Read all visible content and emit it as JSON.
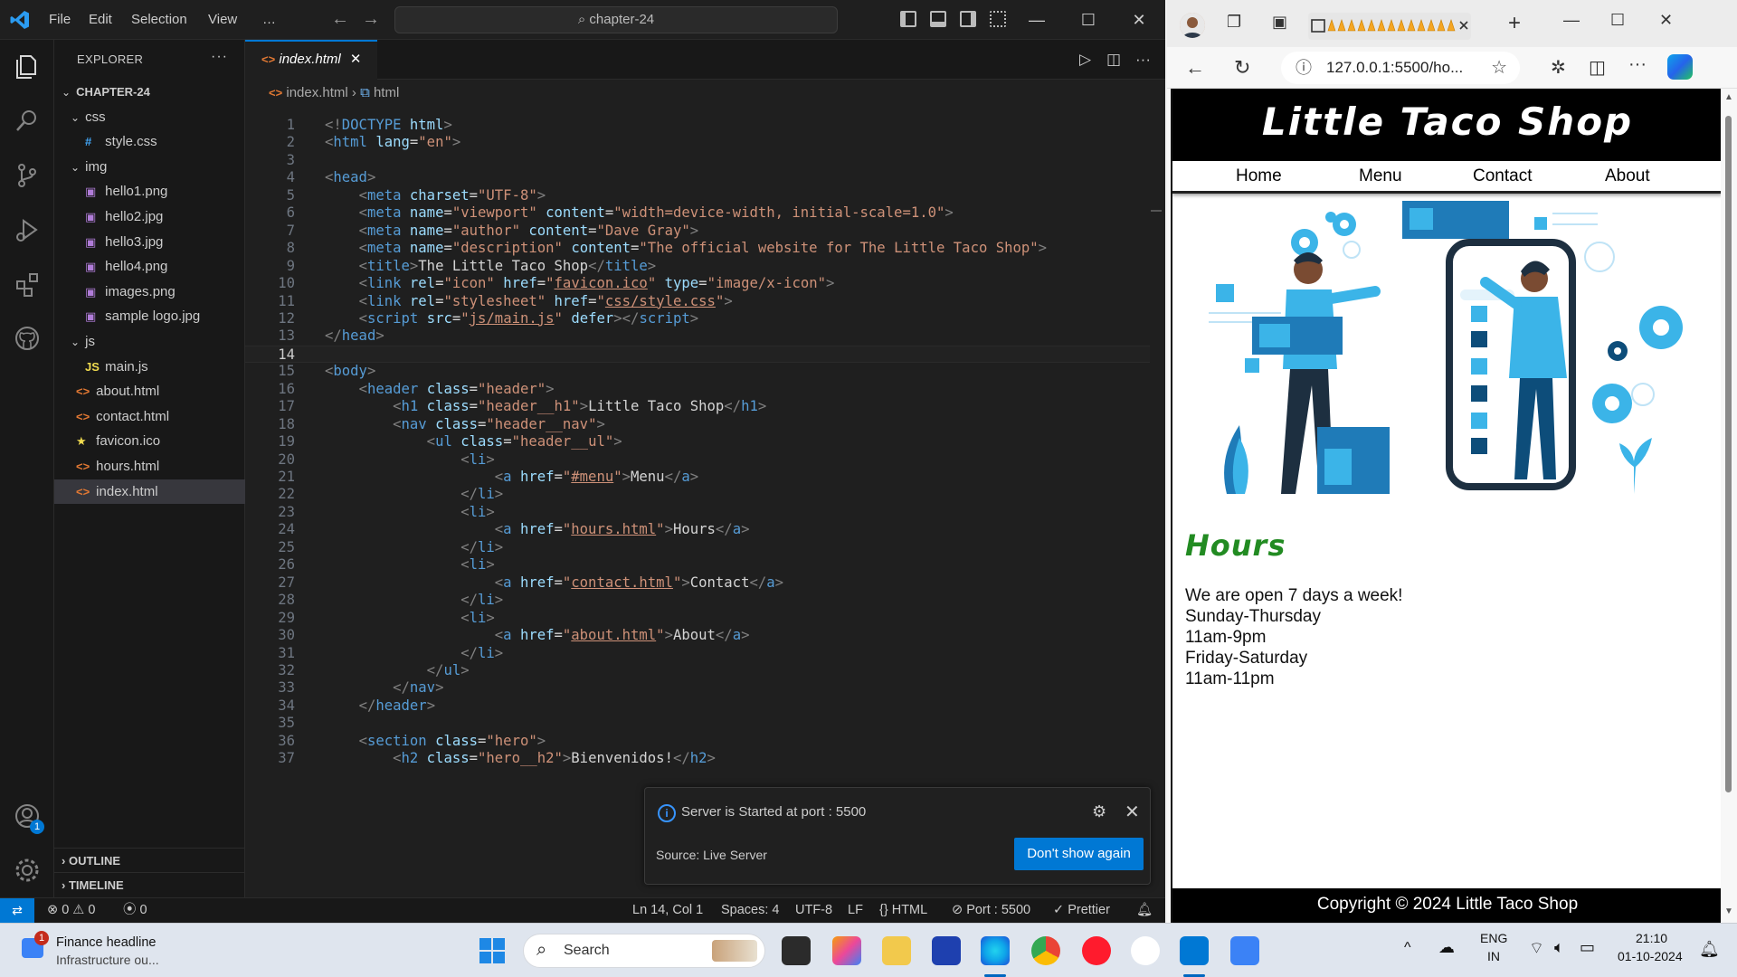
{
  "vscode": {
    "menu": [
      "File",
      "Edit",
      "Selection",
      "View",
      "…"
    ],
    "search_text": "chapter-24",
    "explorer_title": "EXPLORER",
    "explorer_more": "···",
    "tree": [
      {
        "label": "CHAPTER-24",
        "type": "root",
        "indent": 0
      },
      {
        "label": "css",
        "type": "folder",
        "indent": 1
      },
      {
        "label": "style.css",
        "type": "css",
        "indent": 2
      },
      {
        "label": "img",
        "type": "folder",
        "indent": 1
      },
      {
        "label": "hello1.png",
        "type": "image",
        "indent": 2
      },
      {
        "label": "hello2.jpg",
        "type": "image",
        "indent": 2
      },
      {
        "label": "hello3.jpg",
        "type": "image",
        "indent": 2
      },
      {
        "label": "hello4.png",
        "type": "image",
        "indent": 2
      },
      {
        "label": "images.png",
        "type": "image",
        "indent": 2
      },
      {
        "label": "sample logo.jpg",
        "type": "image",
        "indent": 2
      },
      {
        "label": "js",
        "type": "folder",
        "indent": 1
      },
      {
        "label": "main.js",
        "type": "js",
        "indent": 2
      },
      {
        "label": "about.html",
        "type": "html",
        "indent": 1
      },
      {
        "label": "contact.html",
        "type": "html",
        "indent": 1
      },
      {
        "label": "favicon.ico",
        "type": "ico",
        "indent": 1
      },
      {
        "label": "hours.html",
        "type": "html",
        "indent": 1
      },
      {
        "label": "index.html",
        "type": "html",
        "indent": 1,
        "selected": true
      }
    ],
    "outline_label": "OUTLINE",
    "timeline_label": "TIMELINE",
    "tab_label": "index.html",
    "breadcrumb": [
      "index.html",
      "html"
    ],
    "current_line": 14,
    "code_lines": [
      [
        [
          "tb",
          "<!"
        ],
        [
          "tg",
          "DOCTYPE"
        ],
        [
          "tx",
          " "
        ],
        [
          "at",
          "html"
        ],
        [
          "tb",
          ">"
        ]
      ],
      [
        [
          "tb",
          "<"
        ],
        [
          "tg",
          "html"
        ],
        [
          "tx",
          " "
        ],
        [
          "at",
          "lang"
        ],
        [
          "tx",
          "="
        ],
        [
          "st",
          "\"en\""
        ],
        [
          "tb",
          ">"
        ]
      ],
      [],
      [
        [
          "tb",
          "<"
        ],
        [
          "tg",
          "head"
        ],
        [
          "tb",
          ">"
        ]
      ],
      [
        [
          "tx",
          "    "
        ],
        [
          "tb",
          "<"
        ],
        [
          "tg",
          "meta"
        ],
        [
          "tx",
          " "
        ],
        [
          "at",
          "charset"
        ],
        [
          "tx",
          "="
        ],
        [
          "st",
          "\"UTF-8\""
        ],
        [
          "tb",
          ">"
        ]
      ],
      [
        [
          "tx",
          "    "
        ],
        [
          "tb",
          "<"
        ],
        [
          "tg",
          "meta"
        ],
        [
          "tx",
          " "
        ],
        [
          "at",
          "name"
        ],
        [
          "tx",
          "="
        ],
        [
          "st",
          "\"viewport\""
        ],
        [
          "tx",
          " "
        ],
        [
          "at",
          "content"
        ],
        [
          "tx",
          "="
        ],
        [
          "st",
          "\"width=device-width, initial-scale=1.0\""
        ],
        [
          "tb",
          ">"
        ]
      ],
      [
        [
          "tx",
          "    "
        ],
        [
          "tb",
          "<"
        ],
        [
          "tg",
          "meta"
        ],
        [
          "tx",
          " "
        ],
        [
          "at",
          "name"
        ],
        [
          "tx",
          "="
        ],
        [
          "st",
          "\"author\""
        ],
        [
          "tx",
          " "
        ],
        [
          "at",
          "content"
        ],
        [
          "tx",
          "="
        ],
        [
          "st",
          "\"Dave Gray\""
        ],
        [
          "tb",
          ">"
        ]
      ],
      [
        [
          "tx",
          "    "
        ],
        [
          "tb",
          "<"
        ],
        [
          "tg",
          "meta"
        ],
        [
          "tx",
          " "
        ],
        [
          "at",
          "name"
        ],
        [
          "tx",
          "="
        ],
        [
          "st",
          "\"description\""
        ],
        [
          "tx",
          " "
        ],
        [
          "at",
          "content"
        ],
        [
          "tx",
          "="
        ],
        [
          "st",
          "\"The official website for The Little Taco Shop\""
        ],
        [
          "tb",
          ">"
        ]
      ],
      [
        [
          "tx",
          "    "
        ],
        [
          "tb",
          "<"
        ],
        [
          "tg",
          "title"
        ],
        [
          "tb",
          ">"
        ],
        [
          "tx",
          "The Little Taco Shop"
        ],
        [
          "tb",
          "</"
        ],
        [
          "tg",
          "title"
        ],
        [
          "tb",
          ">"
        ]
      ],
      [
        [
          "tx",
          "    "
        ],
        [
          "tb",
          "<"
        ],
        [
          "tg",
          "link"
        ],
        [
          "tx",
          " "
        ],
        [
          "at",
          "rel"
        ],
        [
          "tx",
          "="
        ],
        [
          "st",
          "\"icon\""
        ],
        [
          "tx",
          " "
        ],
        [
          "at",
          "href"
        ],
        [
          "tx",
          "="
        ],
        [
          "st",
          "\""
        ],
        [
          "lk",
          "favicon.ico"
        ],
        [
          "st",
          "\""
        ],
        [
          "tx",
          " "
        ],
        [
          "at",
          "type"
        ],
        [
          "tx",
          "="
        ],
        [
          "st",
          "\"image/x-icon\""
        ],
        [
          "tb",
          ">"
        ]
      ],
      [
        [
          "tx",
          "    "
        ],
        [
          "tb",
          "<"
        ],
        [
          "tg",
          "link"
        ],
        [
          "tx",
          " "
        ],
        [
          "at",
          "rel"
        ],
        [
          "tx",
          "="
        ],
        [
          "st",
          "\"stylesheet\""
        ],
        [
          "tx",
          " "
        ],
        [
          "at",
          "href"
        ],
        [
          "tx",
          "="
        ],
        [
          "st",
          "\""
        ],
        [
          "lk",
          "css/style.css"
        ],
        [
          "st",
          "\""
        ],
        [
          "tb",
          ">"
        ]
      ],
      [
        [
          "tx",
          "    "
        ],
        [
          "tb",
          "<"
        ],
        [
          "tg",
          "script"
        ],
        [
          "tx",
          " "
        ],
        [
          "at",
          "src"
        ],
        [
          "tx",
          "="
        ],
        [
          "st",
          "\""
        ],
        [
          "lk",
          "js/main.js"
        ],
        [
          "st",
          "\""
        ],
        [
          "tx",
          " "
        ],
        [
          "at",
          "defer"
        ],
        [
          "tb",
          "></"
        ],
        [
          "tg",
          "script"
        ],
        [
          "tb",
          ">"
        ]
      ],
      [
        [
          "tb",
          "</"
        ],
        [
          "tg",
          "head"
        ],
        [
          "tb",
          ">"
        ]
      ],
      [],
      [
        [
          "tb",
          "<"
        ],
        [
          "tg",
          "body"
        ],
        [
          "tb",
          ">"
        ]
      ],
      [
        [
          "tx",
          "    "
        ],
        [
          "tb",
          "<"
        ],
        [
          "tg",
          "header"
        ],
        [
          "tx",
          " "
        ],
        [
          "at",
          "class"
        ],
        [
          "tx",
          "="
        ],
        [
          "st",
          "\"header\""
        ],
        [
          "tb",
          ">"
        ]
      ],
      [
        [
          "tx",
          "        "
        ],
        [
          "tb",
          "<"
        ],
        [
          "tg",
          "h1"
        ],
        [
          "tx",
          " "
        ],
        [
          "at",
          "class"
        ],
        [
          "tx",
          "="
        ],
        [
          "st",
          "\"header__h1\""
        ],
        [
          "tb",
          ">"
        ],
        [
          "tx",
          "Little Taco Shop"
        ],
        [
          "tb",
          "</"
        ],
        [
          "tg",
          "h1"
        ],
        [
          "tb",
          ">"
        ]
      ],
      [
        [
          "tx",
          "        "
        ],
        [
          "tb",
          "<"
        ],
        [
          "tg",
          "nav"
        ],
        [
          "tx",
          " "
        ],
        [
          "at",
          "class"
        ],
        [
          "tx",
          "="
        ],
        [
          "st",
          "\"header__nav\""
        ],
        [
          "tb",
          ">"
        ]
      ],
      [
        [
          "tx",
          "            "
        ],
        [
          "tb",
          "<"
        ],
        [
          "tg",
          "ul"
        ],
        [
          "tx",
          " "
        ],
        [
          "at",
          "class"
        ],
        [
          "tx",
          "="
        ],
        [
          "st",
          "\"header__ul\""
        ],
        [
          "tb",
          ">"
        ]
      ],
      [
        [
          "tx",
          "                "
        ],
        [
          "tb",
          "<"
        ],
        [
          "tg",
          "li"
        ],
        [
          "tb",
          ">"
        ]
      ],
      [
        [
          "tx",
          "                    "
        ],
        [
          "tb",
          "<"
        ],
        [
          "tg",
          "a"
        ],
        [
          "tx",
          " "
        ],
        [
          "at",
          "href"
        ],
        [
          "tx",
          "="
        ],
        [
          "st",
          "\""
        ],
        [
          "lk",
          "#menu"
        ],
        [
          "st",
          "\""
        ],
        [
          "tb",
          ">"
        ],
        [
          "tx",
          "Menu"
        ],
        [
          "tb",
          "</"
        ],
        [
          "tg",
          "a"
        ],
        [
          "tb",
          ">"
        ]
      ],
      [
        [
          "tx",
          "                "
        ],
        [
          "tb",
          "</"
        ],
        [
          "tg",
          "li"
        ],
        [
          "tb",
          ">"
        ]
      ],
      [
        [
          "tx",
          "                "
        ],
        [
          "tb",
          "<"
        ],
        [
          "tg",
          "li"
        ],
        [
          "tb",
          ">"
        ]
      ],
      [
        [
          "tx",
          "                    "
        ],
        [
          "tb",
          "<"
        ],
        [
          "tg",
          "a"
        ],
        [
          "tx",
          " "
        ],
        [
          "at",
          "href"
        ],
        [
          "tx",
          "="
        ],
        [
          "st",
          "\""
        ],
        [
          "lk",
          "hours.html"
        ],
        [
          "st",
          "\""
        ],
        [
          "tb",
          ">"
        ],
        [
          "tx",
          "Hours"
        ],
        [
          "tb",
          "</"
        ],
        [
          "tg",
          "a"
        ],
        [
          "tb",
          ">"
        ]
      ],
      [
        [
          "tx",
          "                "
        ],
        [
          "tb",
          "</"
        ],
        [
          "tg",
          "li"
        ],
        [
          "tb",
          ">"
        ]
      ],
      [
        [
          "tx",
          "                "
        ],
        [
          "tb",
          "<"
        ],
        [
          "tg",
          "li"
        ],
        [
          "tb",
          ">"
        ]
      ],
      [
        [
          "tx",
          "                    "
        ],
        [
          "tb",
          "<"
        ],
        [
          "tg",
          "a"
        ],
        [
          "tx",
          " "
        ],
        [
          "at",
          "href"
        ],
        [
          "tx",
          "="
        ],
        [
          "st",
          "\""
        ],
        [
          "lk",
          "contact.html"
        ],
        [
          "st",
          "\""
        ],
        [
          "tb",
          ">"
        ],
        [
          "tx",
          "Contact"
        ],
        [
          "tb",
          "</"
        ],
        [
          "tg",
          "a"
        ],
        [
          "tb",
          ">"
        ]
      ],
      [
        [
          "tx",
          "                "
        ],
        [
          "tb",
          "</"
        ],
        [
          "tg",
          "li"
        ],
        [
          "tb",
          ">"
        ]
      ],
      [
        [
          "tx",
          "                "
        ],
        [
          "tb",
          "<"
        ],
        [
          "tg",
          "li"
        ],
        [
          "tb",
          ">"
        ]
      ],
      [
        [
          "tx",
          "                    "
        ],
        [
          "tb",
          "<"
        ],
        [
          "tg",
          "a"
        ],
        [
          "tx",
          " "
        ],
        [
          "at",
          "href"
        ],
        [
          "tx",
          "="
        ],
        [
          "st",
          "\""
        ],
        [
          "lk",
          "about.html"
        ],
        [
          "st",
          "\""
        ],
        [
          "tb",
          ">"
        ],
        [
          "tx",
          "About"
        ],
        [
          "tb",
          "</"
        ],
        [
          "tg",
          "a"
        ],
        [
          "tb",
          ">"
        ]
      ],
      [
        [
          "tx",
          "                "
        ],
        [
          "tb",
          "</"
        ],
        [
          "tg",
          "li"
        ],
        [
          "tb",
          ">"
        ]
      ],
      [
        [
          "tx",
          "            "
        ],
        [
          "tb",
          "</"
        ],
        [
          "tg",
          "ul"
        ],
        [
          "tb",
          ">"
        ]
      ],
      [
        [
          "tx",
          "        "
        ],
        [
          "tb",
          "</"
        ],
        [
          "tg",
          "nav"
        ],
        [
          "tb",
          ">"
        ]
      ],
      [
        [
          "tx",
          "    "
        ],
        [
          "tb",
          "</"
        ],
        [
          "tg",
          "header"
        ],
        [
          "tb",
          ">"
        ]
      ],
      [],
      [
        [
          "tx",
          "    "
        ],
        [
          "tb",
          "<"
        ],
        [
          "tg",
          "section"
        ],
        [
          "tx",
          " "
        ],
        [
          "at",
          "class"
        ],
        [
          "tx",
          "="
        ],
        [
          "st",
          "\"hero\""
        ],
        [
          "tb",
          ">"
        ]
      ],
      [
        [
          "tx",
          "        "
        ],
        [
          "tb",
          "<"
        ],
        [
          "tg",
          "h2"
        ],
        [
          "tx",
          " "
        ],
        [
          "at",
          "class"
        ],
        [
          "tx",
          "="
        ],
        [
          "st",
          "\"hero__h2\""
        ],
        [
          "tb",
          ">"
        ],
        [
          "tx",
          "Bienvenidos!"
        ],
        [
          "tb",
          "</"
        ],
        [
          "tg",
          "h2"
        ],
        [
          "tb",
          ">"
        ]
      ]
    ],
    "notification": {
      "message": "Server is Started at port : 5500",
      "source": "Source: Live Server",
      "button": "Don't show again"
    },
    "status": {
      "errors": "0",
      "warnings": "0",
      "ports": "0",
      "position": "Ln 14, Col 1",
      "spaces": "Spaces: 4",
      "encoding": "UTF-8",
      "eol": "LF",
      "language": "HTML",
      "port": "Port : 5500",
      "formatter": "Prettier"
    },
    "accounts_badge": "1"
  },
  "edge": {
    "url": "127.0.0.1:5500/ho...",
    "site": {
      "title": "Little Taco Shop",
      "nav": [
        "Home",
        "Menu",
        "Contact",
        "About"
      ],
      "hours_heading": "Hours",
      "hours_lines": [
        "We are open 7 days a week!",
        "Sunday-Thursday",
        "11am-9pm",
        "Friday-Saturday",
        "11am-11pm"
      ],
      "footer": "Copyright © 2024 Little Taco Shop"
    }
  },
  "taskbar": {
    "news_title": "Finance headline",
    "news_sub": "Infrastructure ou...",
    "news_badge": "1",
    "search": "Search",
    "lang_1": "ENG",
    "lang_2": "IN",
    "time": "21:10",
    "date": "01-10-2024"
  },
  "colors": {
    "accent": "#0078d4",
    "html_tag": "#569cd6",
    "attr": "#9cdcfe",
    "string": "#ce9178",
    "hours_green": "#228b22"
  }
}
